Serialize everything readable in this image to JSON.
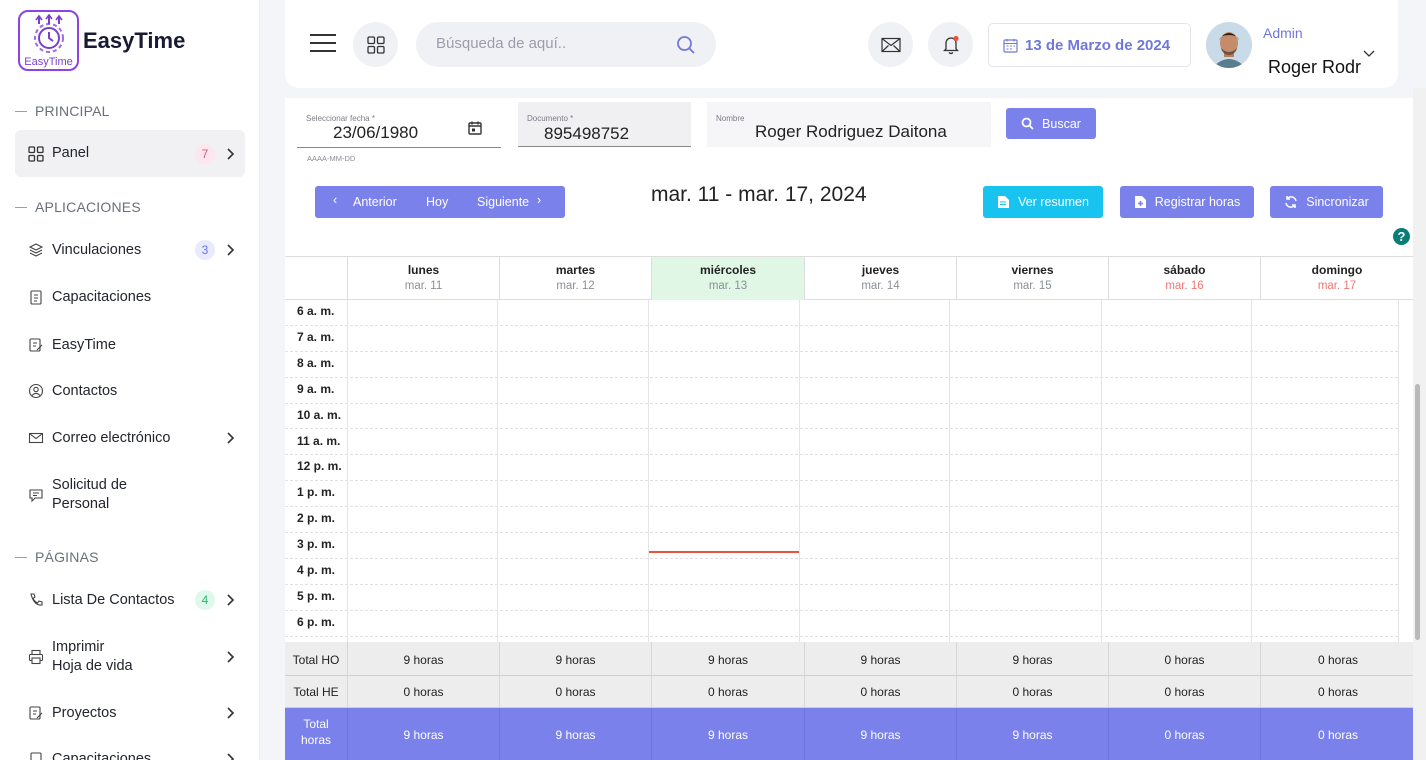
{
  "brand": {
    "name": "EasyTime",
    "logo_text": "EasyTime"
  },
  "sidebar": {
    "sections": [
      "PRINCIPAL",
      "APLICACIONES",
      "PÁGINAS"
    ],
    "items": [
      {
        "label": "Panel",
        "badge": "7",
        "icon": "grid-icon"
      },
      {
        "label": "Vinculaciones",
        "badge": "3",
        "icon": "layers-icon"
      },
      {
        "label": "Capacitaciones",
        "icon": "clipboard-icon"
      },
      {
        "label": "EasyTime",
        "icon": "edit-document-icon"
      },
      {
        "label": "Contactos",
        "icon": "user-circle-icon"
      },
      {
        "label": "Correo electrónico",
        "icon": "mail-icon"
      },
      {
        "label": "Solicitud de Personal",
        "icon": "chat-icon"
      },
      {
        "label": "Lista De Contactos",
        "badge": "4",
        "icon": "phone-icon"
      },
      {
        "label": "Imprimir Hoja de vida",
        "icon": "printer-icon"
      },
      {
        "label": "Proyectos",
        "icon": "edit-document-icon"
      },
      {
        "label": "Capacitaciones",
        "icon": "clipboard-icon"
      }
    ]
  },
  "header": {
    "search_placeholder": "Búsqueda de aquí..",
    "date": "13 de Marzo de 2024",
    "user_role": "Admin",
    "user_name": "Roger Rodr"
  },
  "form": {
    "date_label": "Seleccionar fecha *",
    "date_value": "23/06/1980",
    "date_hint": "AAAA-MM-DD",
    "doc_label": "Documento *",
    "doc_value": "895498752",
    "name_label": "Nombre",
    "name_value": "Roger Rodriguez Daitona",
    "search_button": "Buscar"
  },
  "toolbar": {
    "prev": "Anterior",
    "today": "Hoy",
    "next": "Siguiente",
    "range_title": "mar. 11 - mar. 17, 2024",
    "summary_button": "Ver resumen",
    "register_button": "Registrar horas",
    "sync_button": "Sincronizar",
    "help": "?"
  },
  "calendar": {
    "days": [
      {
        "name": "lunes",
        "date": "mar. 11"
      },
      {
        "name": "martes",
        "date": "mar. 12"
      },
      {
        "name": "miércoles",
        "date": "mar. 13",
        "today": true
      },
      {
        "name": "jueves",
        "date": "mar. 14"
      },
      {
        "name": "viernes",
        "date": "mar. 15"
      },
      {
        "name": "sábado",
        "date": "mar. 16",
        "weekend": true
      },
      {
        "name": "domingo",
        "date": "mar. 17",
        "weekend": true
      }
    ],
    "hours": [
      "6 a. m.",
      "7 a. m.",
      "8 a. m.",
      "9 a. m.",
      "10 a. m.",
      "11 a. m.",
      "12 p. m.",
      "1 p. m.",
      "2 p. m.",
      "3 p. m.",
      "4 p. m.",
      "5 p. m.",
      "6 p. m."
    ],
    "colors": {
      "today_bg": "#dff7e4",
      "weekend_date": "#f07672",
      "now_line": "#e8553f",
      "accent": "#7a81ea"
    }
  },
  "totals": {
    "rows": [
      {
        "label": "Total HO",
        "values": [
          "9 horas",
          "9 horas",
          "9 horas",
          "9 horas",
          "9 horas",
          "0 horas",
          "0 horas"
        ]
      },
      {
        "label": "Total HE",
        "values": [
          "0 horas",
          "0 horas",
          "0 horas",
          "0 horas",
          "0 horas",
          "0 horas",
          "0 horas"
        ]
      },
      {
        "label": "Total horas",
        "values": [
          "9 horas",
          "9 horas",
          "9 horas",
          "9 horas",
          "9 horas",
          "0 horas",
          "0 horas"
        ]
      }
    ]
  }
}
